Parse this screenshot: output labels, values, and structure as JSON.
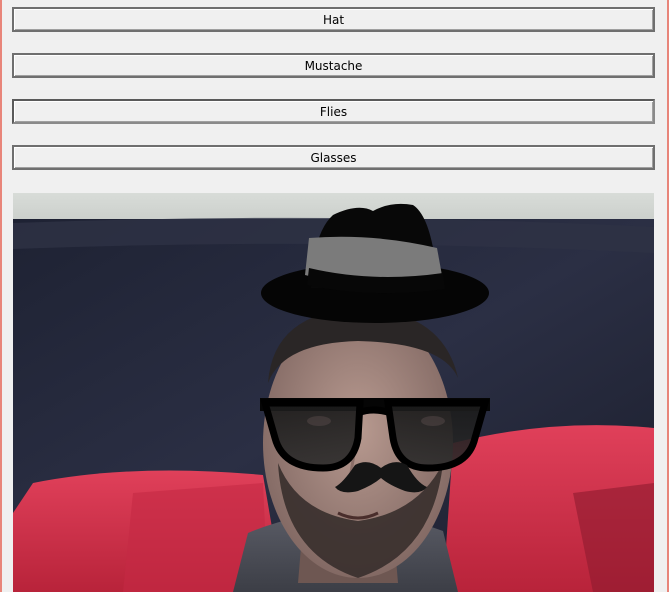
{
  "buttons": {
    "hat_label": "Hat",
    "mustache_label": "Mustache",
    "flies_label": "Flies",
    "glasses_label": "Glasses"
  },
  "overlays": {
    "hat": "fedora-hat",
    "glasses": "sunglasses",
    "mustache": "mustache"
  },
  "colors": {
    "window_border": "#e8857a",
    "button_face": "#f0f0f0",
    "hat_band": "#808080"
  }
}
